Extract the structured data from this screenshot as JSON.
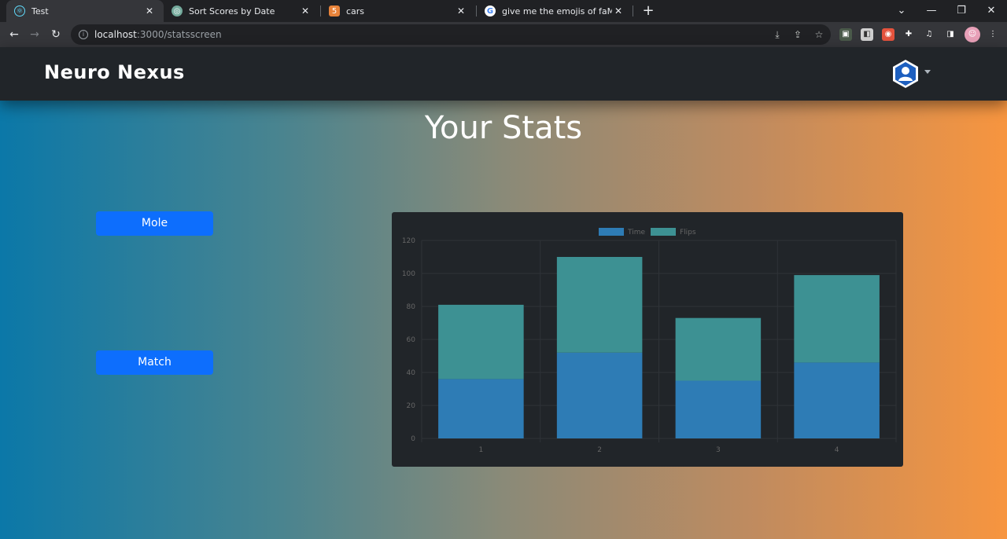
{
  "browser": {
    "tabs": [
      {
        "title": "Test",
        "icon": "react-icon",
        "active": true
      },
      {
        "title": "Sort Scores by Date",
        "icon": "chatgpt-icon",
        "active": false
      },
      {
        "title": "cars",
        "icon": "html-file-icon",
        "active": false
      },
      {
        "title": "give me the emojis of faMOUS C",
        "icon": "google-icon",
        "active": false
      }
    ],
    "url_host": "localhost",
    "url_path": ":3000/statsscreen",
    "close_glyph": "✕",
    "new_tab_glyph": "+"
  },
  "navbar": {
    "brand": "Neuro Nexus",
    "accent": "#212529"
  },
  "page": {
    "title": "Your Stats",
    "buttons": [
      {
        "label": "Mole"
      },
      {
        "label": "Match"
      }
    ],
    "button_color": "#0d6efd"
  },
  "chart_data": {
    "type": "bar",
    "stacked": true,
    "categories": [
      "1",
      "2",
      "3",
      "4"
    ],
    "series": [
      {
        "name": "Time",
        "values": [
          36,
          52,
          35,
          46
        ],
        "color": "#2e7cb5"
      },
      {
        "name": "Flips",
        "values": [
          45,
          58,
          38,
          53
        ],
        "color": "#3d9193"
      }
    ],
    "ylim": [
      0,
      120
    ],
    "yticks": [
      0,
      20,
      40,
      60,
      80,
      100,
      120
    ],
    "legend": "top-center",
    "grid": true
  }
}
